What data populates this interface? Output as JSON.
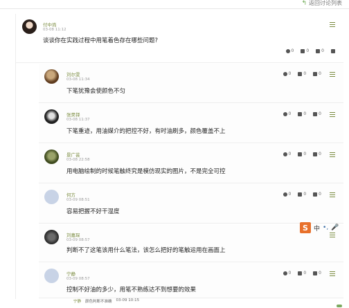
{
  "header": {
    "back_label": "返回讨论列表"
  },
  "topic": {
    "name": "付中尚",
    "time": "03-08 11:12",
    "content": "谈谈你在实践过程中用笔着色存在哪些问题?",
    "stats": {
      "a": "0",
      "b": "0",
      "c": "0"
    }
  },
  "replies": [
    {
      "name": "刘尔雯",
      "time": "03-08 11:34",
      "content": "下笔犹豫会使颜色不匀",
      "stats": {
        "a": "0",
        "b": "0",
        "c": "0"
      }
    },
    {
      "name": "张昊铎",
      "time": "03-08 11:37",
      "content": "下笔重迹，用油媒介的把控不好，有时油刷多，颜色覆盖不上",
      "stats": {
        "a": "0",
        "b": "0",
        "c": "0"
      }
    },
    {
      "name": "景广芸",
      "time": "03-08 22:58",
      "content": "用电脑绘制的时候笔触终究是模仿现实的图片，不是完全可控",
      "stats": {
        "a": "0",
        "b": "0",
        "c": "0"
      }
    },
    {
      "name": "何方",
      "time": "03-09 08:51",
      "content": "容易把握不好干湿度",
      "stats": {
        "a": "0",
        "b": "0",
        "c": "0"
      }
    },
    {
      "name": "刘嘉琛",
      "time": "03-09 08:57",
      "content": "判断不了这笔该用什么笔法，该怎么把好的笔触运用在画面上",
      "stats": {
        "a": "0",
        "b": "0",
        "c": "0"
      }
    },
    {
      "name": "宁静",
      "time": "03-09 08:57",
      "content": "控制不好油的多少，用笔不熟练达不到想要的效果",
      "stats": {
        "a": "0",
        "b": "0",
        "c": "0"
      }
    }
  ],
  "ime": {
    "logo": "S",
    "label": "中"
  },
  "bottom": {
    "name": "宁静",
    "text": "颜色判断不准确",
    "time": "03-09 10:15"
  }
}
